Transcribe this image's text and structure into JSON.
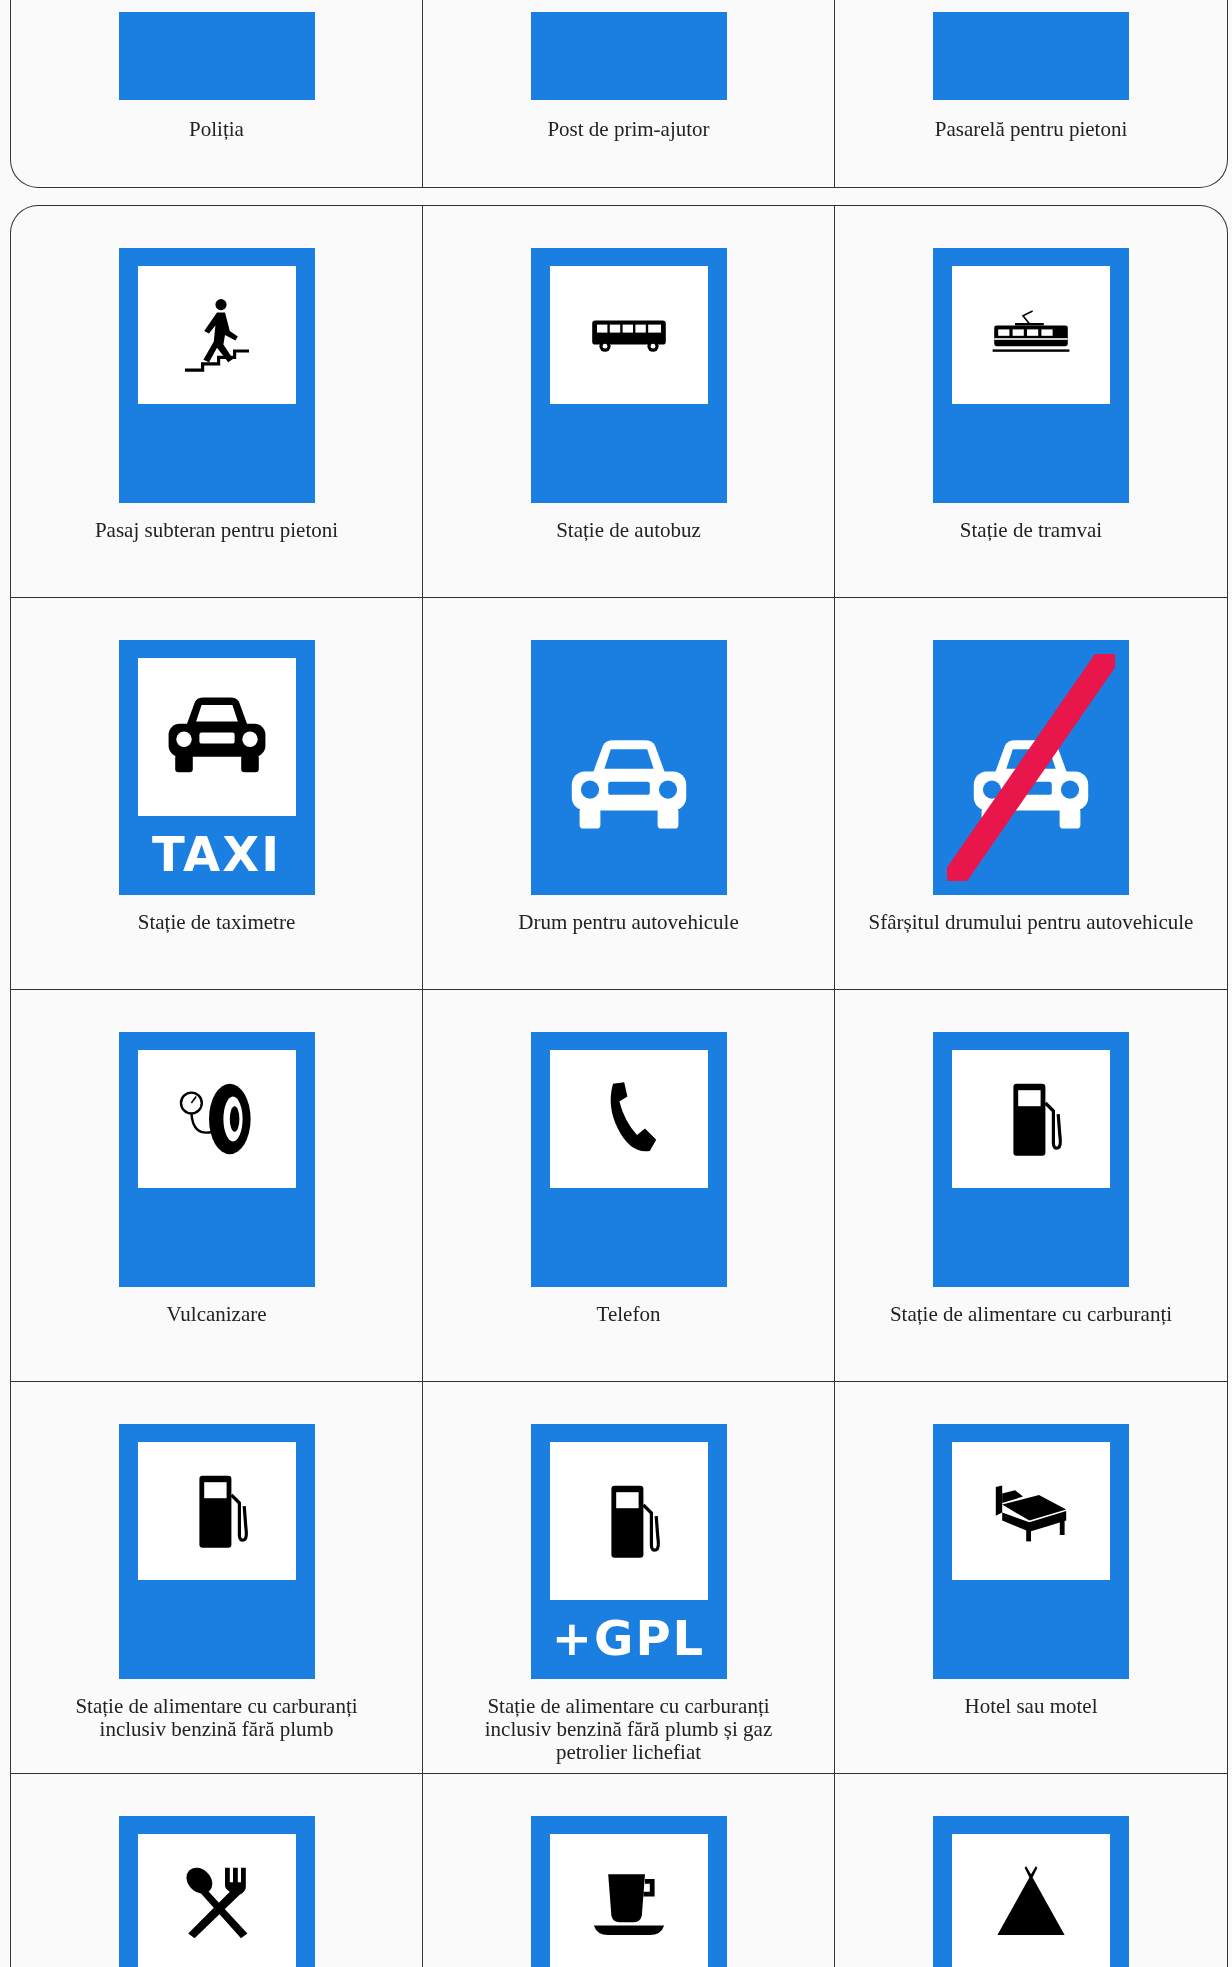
{
  "previous_table": {
    "cells": [
      {
        "label": "Poliția"
      },
      {
        "label": "Post de prim-ajutor"
      },
      {
        "label": "Pasarelă pentru pietoni"
      }
    ]
  },
  "table": {
    "rows": [
      [
        {
          "label": "Pasaj subteran pentru pietoni",
          "sign": {
            "kind": "underpass"
          }
        },
        {
          "label": "Stație de autobuz",
          "sign": {
            "kind": "bus"
          }
        },
        {
          "label": "Stație de tramvai",
          "sign": {
            "kind": "tram"
          }
        }
      ],
      [
        {
          "label": "Stație de taximetre",
          "sign": {
            "kind": "taxi",
            "text": "TAXI"
          }
        },
        {
          "label": "Drum pentru autovehicule",
          "sign": {
            "kind": "car"
          }
        },
        {
          "label": "Sfârșitul drumului pentru autovehicule",
          "sign": {
            "kind": "car-end"
          }
        }
      ],
      [
        {
          "label": "Vulcanizare",
          "sign": {
            "kind": "tire"
          }
        },
        {
          "label": "Telefon",
          "sign": {
            "kind": "phone"
          }
        },
        {
          "label": "Stație de alimentare cu carburanți",
          "sign": {
            "kind": "fuel"
          }
        }
      ],
      [
        {
          "label": "Stație de alimentare cu carburanți inclusiv benzină fără plumb",
          "sign": {
            "kind": "fuel"
          }
        },
        {
          "label": "Stație de alimentare cu carburanți inclusiv benzină fără plumb și gaz petrolier lichefiat",
          "sign": {
            "kind": "fuel-gpl",
            "text": "+GPL"
          }
        },
        {
          "label": "Hotel sau motel",
          "sign": {
            "kind": "bed"
          }
        }
      ],
      [
        {
          "sign": {
            "kind": "restaurant"
          }
        },
        {
          "sign": {
            "kind": "coffee"
          }
        },
        {
          "sign": {
            "kind": "camping"
          }
        }
      ]
    ]
  }
}
